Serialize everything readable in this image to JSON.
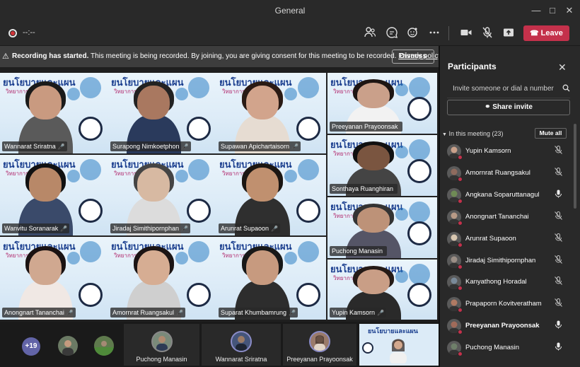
{
  "window": {
    "title": "General",
    "controls": [
      "minimize-icon",
      "maximize-icon",
      "close-icon"
    ]
  },
  "toolbar": {
    "timer": "--:--",
    "icons": [
      "people-icon",
      "chat-icon",
      "reactions-icon",
      "more-icon",
      "camera-icon",
      "mic-off-icon",
      "share-icon"
    ],
    "leave_label": "Leave"
  },
  "banner": {
    "bold": "Recording has started.",
    "text": "This meeting is being recorded. By joining, you are giving consent for this meeting to be recorded.",
    "link": "Privacy policy",
    "dismiss": "Dismiss"
  },
  "slide": {
    "head": "ยนโยบายและแผน",
    "sub": "วิทยาการจัดการ"
  },
  "video_tiles": [
    {
      "name": "Wannarat Sriratna",
      "mic": "🎤"
    },
    {
      "name": "Surapong Nimkoetphon",
      "mic": "🎤"
    },
    {
      "name": "Supawan Apichartaisorn",
      "mic": "🎤"
    },
    {
      "name": "Preeyanan Prayoonsak",
      "mic": ""
    },
    {
      "name": "Wanvitu Soranarak",
      "mic": "🎤"
    },
    {
      "name": "Jiradaj Simithipornphan",
      "mic": "🎤"
    },
    {
      "name": "Arunrat Supaoon",
      "mic": "🎤"
    },
    {
      "name": "Sonthaya Ruanghiran",
      "mic": ""
    },
    {
      "name": "Puchong Manasin",
      "mic": ""
    },
    {
      "name": "Anongnart Tananchai",
      "mic": "🎤"
    },
    {
      "name": "Amornrat Ruangsakul",
      "mic": "🎤"
    },
    {
      "name": "Suparat Khumbamrung",
      "mic": "🎤"
    },
    {
      "name": "Yupin Kamsorn",
      "mic": "🎤"
    }
  ],
  "bottom_strip": {
    "more_count": "+19",
    "tiles": [
      {
        "name": "Puchong Manasin"
      },
      {
        "name": "Wannarat Sriratna"
      },
      {
        "name": "Preeyanan Prayoonsak"
      }
    ]
  },
  "panel": {
    "title": "Participants",
    "invite_placeholder": "Invite someone or dial a number",
    "share_invite": "Share invite",
    "in_meeting": "In this meeting (23)",
    "mute_all": "Mute all",
    "participants": [
      {
        "name": "Yupin Kamsorn",
        "muted": true,
        "color": "#c9a08a"
      },
      {
        "name": "Amornrat Ruangsakul",
        "muted": true,
        "color": "#8f6b5e"
      },
      {
        "name": "Angkana Soparuttanagul",
        "muted": false,
        "color": "#6f8b55"
      },
      {
        "name": "Anongnart Tananchai",
        "muted": true,
        "color": "#b89a86"
      },
      {
        "name": "Arunrat Supaoon",
        "muted": true,
        "color": "#d8c7b0"
      },
      {
        "name": "Jiradaj Simithipornphan",
        "muted": true,
        "color": "#9c8f86"
      },
      {
        "name": "Kanyathong Horadal",
        "muted": true,
        "color": "#7a8a99"
      },
      {
        "name": "Prapaporn Kovitveratham",
        "muted": true,
        "color": "#b07a63"
      },
      {
        "name": "Preeyanan Prayoonsak",
        "muted": false,
        "bold": true,
        "color": "#a06b5a"
      },
      {
        "name": "Puchong Manasin",
        "muted": false,
        "color": "#6f7f6a"
      }
    ]
  }
}
